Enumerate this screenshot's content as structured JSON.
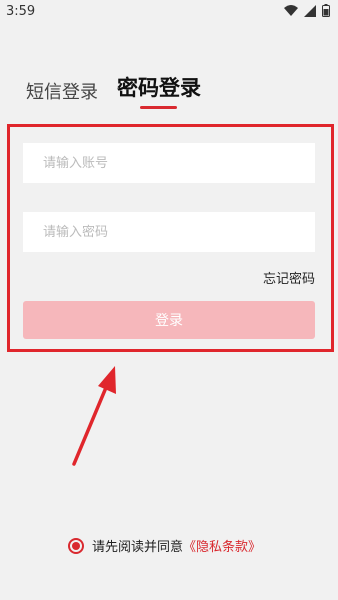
{
  "status_bar": {
    "time": "3:59"
  },
  "tabs": [
    {
      "label": "短信登录",
      "active": false
    },
    {
      "label": "密码登录",
      "active": true
    }
  ],
  "form": {
    "account_placeholder": "请输入账号",
    "account_value": "",
    "password_placeholder": "请输入密码",
    "password_value": "",
    "forgot_label": "忘记密码",
    "login_label": "登录"
  },
  "agreement": {
    "checked": true,
    "text": "请先阅读并同意",
    "link": "《隐私条款》"
  },
  "colors": {
    "accent": "#d9292f",
    "login_button_disabled": "#f6b7bb",
    "background": "#f1f1f1",
    "annotation": "#e0262c"
  }
}
